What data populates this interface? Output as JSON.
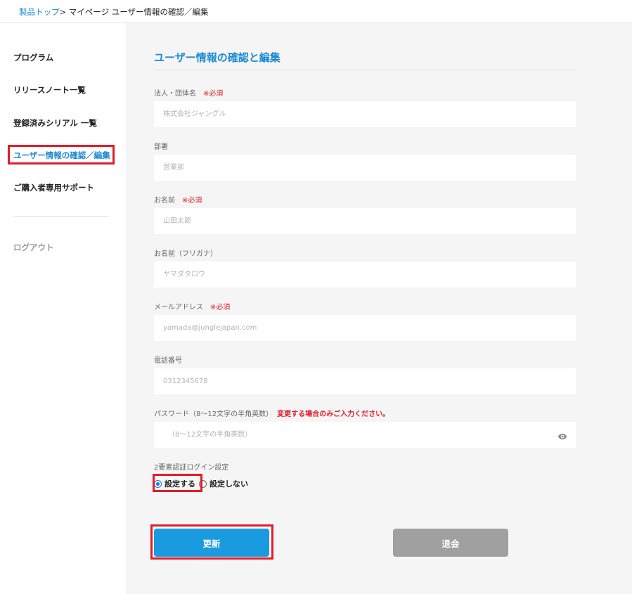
{
  "breadcrumb": {
    "home": "製品トップ",
    "separator": ">",
    "current": "マイページ ユーザー情報の確認／編集"
  },
  "sidebar": {
    "items": [
      {
        "label": "プログラム"
      },
      {
        "label": "リリースノート一覧"
      },
      {
        "label": "登録済みシリアル 一覧"
      },
      {
        "label": "ユーザー情報の確認／編集",
        "active": true
      },
      {
        "label": "ご購入者専用サポート"
      }
    ],
    "logout": "ログアウト"
  },
  "form": {
    "title": "ユーザー情報の確認と編集",
    "required_mark": "※必須",
    "fields": [
      {
        "label": "法人・団体名",
        "required": true,
        "placeholder": "株式会社ジャングル"
      },
      {
        "label": "部署",
        "required": false,
        "placeholder": "営業部"
      },
      {
        "label": "お名前",
        "required": true,
        "placeholder": "山田太郎"
      },
      {
        "label": "お名前（フリガナ）",
        "required": false,
        "placeholder": "ヤマダタロウ"
      },
      {
        "label": "メールアドレス",
        "required": true,
        "placeholder": "yamada@junglejapan.com"
      },
      {
        "label": "電話番号",
        "required": false,
        "placeholder": "0312345678"
      },
      {
        "label": "パスワード（8～12文字の半角英数）",
        "note": "変更する場合のみご入力ください。",
        "placeholder": "（8～12文字の半角英数）",
        "icon": "eye-icon"
      }
    ],
    "two_factor": {
      "label": "2要素認証ログイン設定",
      "options": [
        {
          "label": "設定する",
          "checked": true
        },
        {
          "label": "設定しない",
          "checked": false
        }
      ]
    },
    "update_button": "更新",
    "withdraw_button": "退会"
  },
  "colors": {
    "accent": "#1a8ad4",
    "required": "#e11d2a",
    "update_button": "#1a9be0",
    "withdraw_button": "#a0a0a0",
    "highlight_box": "#e11d2a",
    "main_background": "#f5f5f5"
  }
}
